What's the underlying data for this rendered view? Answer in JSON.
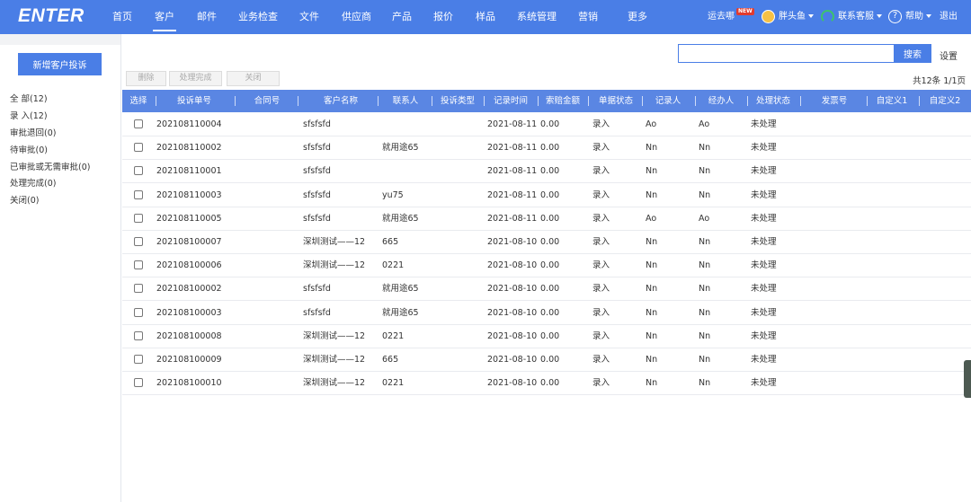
{
  "app": {
    "logo": "ENTER"
  },
  "nav": {
    "items": [
      {
        "label": "首页"
      },
      {
        "label": "客户"
      },
      {
        "label": "邮件"
      },
      {
        "label": "业务检查"
      },
      {
        "label": "文件"
      },
      {
        "label": "供应商"
      },
      {
        "label": "产品"
      },
      {
        "label": "报价"
      },
      {
        "label": "样品"
      },
      {
        "label": "系统管理"
      },
      {
        "label": "营销"
      },
      {
        "label": "更多"
      }
    ],
    "active": "客户",
    "right": {
      "goto": "运去哪",
      "new_badge": "NEW",
      "user": "胖头鱼",
      "service": "联系客服",
      "help": "帮助",
      "help_icon": "?",
      "logout": "退出"
    }
  },
  "sidebar": {
    "add_button": "新增客户投诉",
    "items": [
      {
        "label": "全 部(12)"
      },
      {
        "label": "录 入(12)"
      },
      {
        "label": "审批退回(0)"
      },
      {
        "label": "待审批(0)"
      },
      {
        "label": "已审批或无需审批(0)"
      },
      {
        "label": "处理完成(0)"
      },
      {
        "label": "关闭(0)"
      }
    ]
  },
  "toolbar": {
    "search_placeholder": "",
    "search_button": "搜索",
    "settings": "设置",
    "actions": [
      {
        "label": "删除"
      },
      {
        "label": "处理完成"
      },
      {
        "label": "关闭"
      }
    ],
    "page_count": "共12条 1/1页"
  },
  "table": {
    "columns": [
      "选择",
      "投诉单号",
      "合同号",
      "客户名称",
      "联系人",
      "投诉类型",
      "记录时间",
      "索赔金额",
      "单据状态",
      "记录人",
      "经办人",
      "处理状态",
      "发票号",
      "自定义1",
      "自定义2"
    ],
    "rows": [
      {
        "id": "202108110004",
        "customer": "sfsfsfd",
        "contact": "",
        "time": "2021-08-11",
        "amount": "0.00",
        "status": "录入",
        "recorder": "Ao",
        "handler": "Ao",
        "process": "未处理"
      },
      {
        "id": "202108110002",
        "customer": "sfsfsfd",
        "contact": "就用途65",
        "time": "2021-08-11",
        "amount": "0.00",
        "status": "录入",
        "recorder": "Nn",
        "handler": "Nn",
        "process": "未处理"
      },
      {
        "id": "202108110001",
        "customer": "sfsfsfd",
        "contact": "",
        "time": "2021-08-11",
        "amount": "0.00",
        "status": "录入",
        "recorder": "Nn",
        "handler": "Nn",
        "process": "未处理"
      },
      {
        "id": "202108110003",
        "customer": "sfsfsfd",
        "contact": "yu75",
        "time": "2021-08-11",
        "amount": "0.00",
        "status": "录入",
        "recorder": "Nn",
        "handler": "Nn",
        "process": "未处理"
      },
      {
        "id": "202108110005",
        "customer": "sfsfsfd",
        "contact": "就用途65",
        "time": "2021-08-11",
        "amount": "0.00",
        "status": "录入",
        "recorder": "Ao",
        "handler": "Ao",
        "process": "未处理"
      },
      {
        "id": "202108100007",
        "customer": "深圳测试——12",
        "contact": "665",
        "time": "2021-08-10",
        "amount": "0.00",
        "status": "录入",
        "recorder": "Nn",
        "handler": "Nn",
        "process": "未处理"
      },
      {
        "id": "202108100006",
        "customer": "深圳测试——12",
        "contact": "0221",
        "time": "2021-08-10",
        "amount": "0.00",
        "status": "录入",
        "recorder": "Nn",
        "handler": "Nn",
        "process": "未处理"
      },
      {
        "id": "202108100002",
        "customer": "sfsfsfd",
        "contact": "就用途65",
        "time": "2021-08-10",
        "amount": "0.00",
        "status": "录入",
        "recorder": "Nn",
        "handler": "Nn",
        "process": "未处理"
      },
      {
        "id": "202108100003",
        "customer": "sfsfsfd",
        "contact": "就用途65",
        "time": "2021-08-10",
        "amount": "0.00",
        "status": "录入",
        "recorder": "Nn",
        "handler": "Nn",
        "process": "未处理"
      },
      {
        "id": "202108100008",
        "customer": "深圳测试——12",
        "contact": "0221",
        "time": "2021-08-10",
        "amount": "0.00",
        "status": "录入",
        "recorder": "Nn",
        "handler": "Nn",
        "process": "未处理"
      },
      {
        "id": "202108100009",
        "customer": "深圳测试——12",
        "contact": "665",
        "time": "2021-08-10",
        "amount": "0.00",
        "status": "录入",
        "recorder": "Nn",
        "handler": "Nn",
        "process": "未处理"
      },
      {
        "id": "202108100010",
        "customer": "深圳测试——12",
        "contact": "0221",
        "time": "2021-08-10",
        "amount": "0.00",
        "status": "录入",
        "recorder": "Nn",
        "handler": "Nn",
        "process": "未处理"
      }
    ]
  },
  "colors": {
    "nav_bg": "#4a7ee6",
    "header_bg": "#5a86e3",
    "badge": "#e23b2e"
  }
}
